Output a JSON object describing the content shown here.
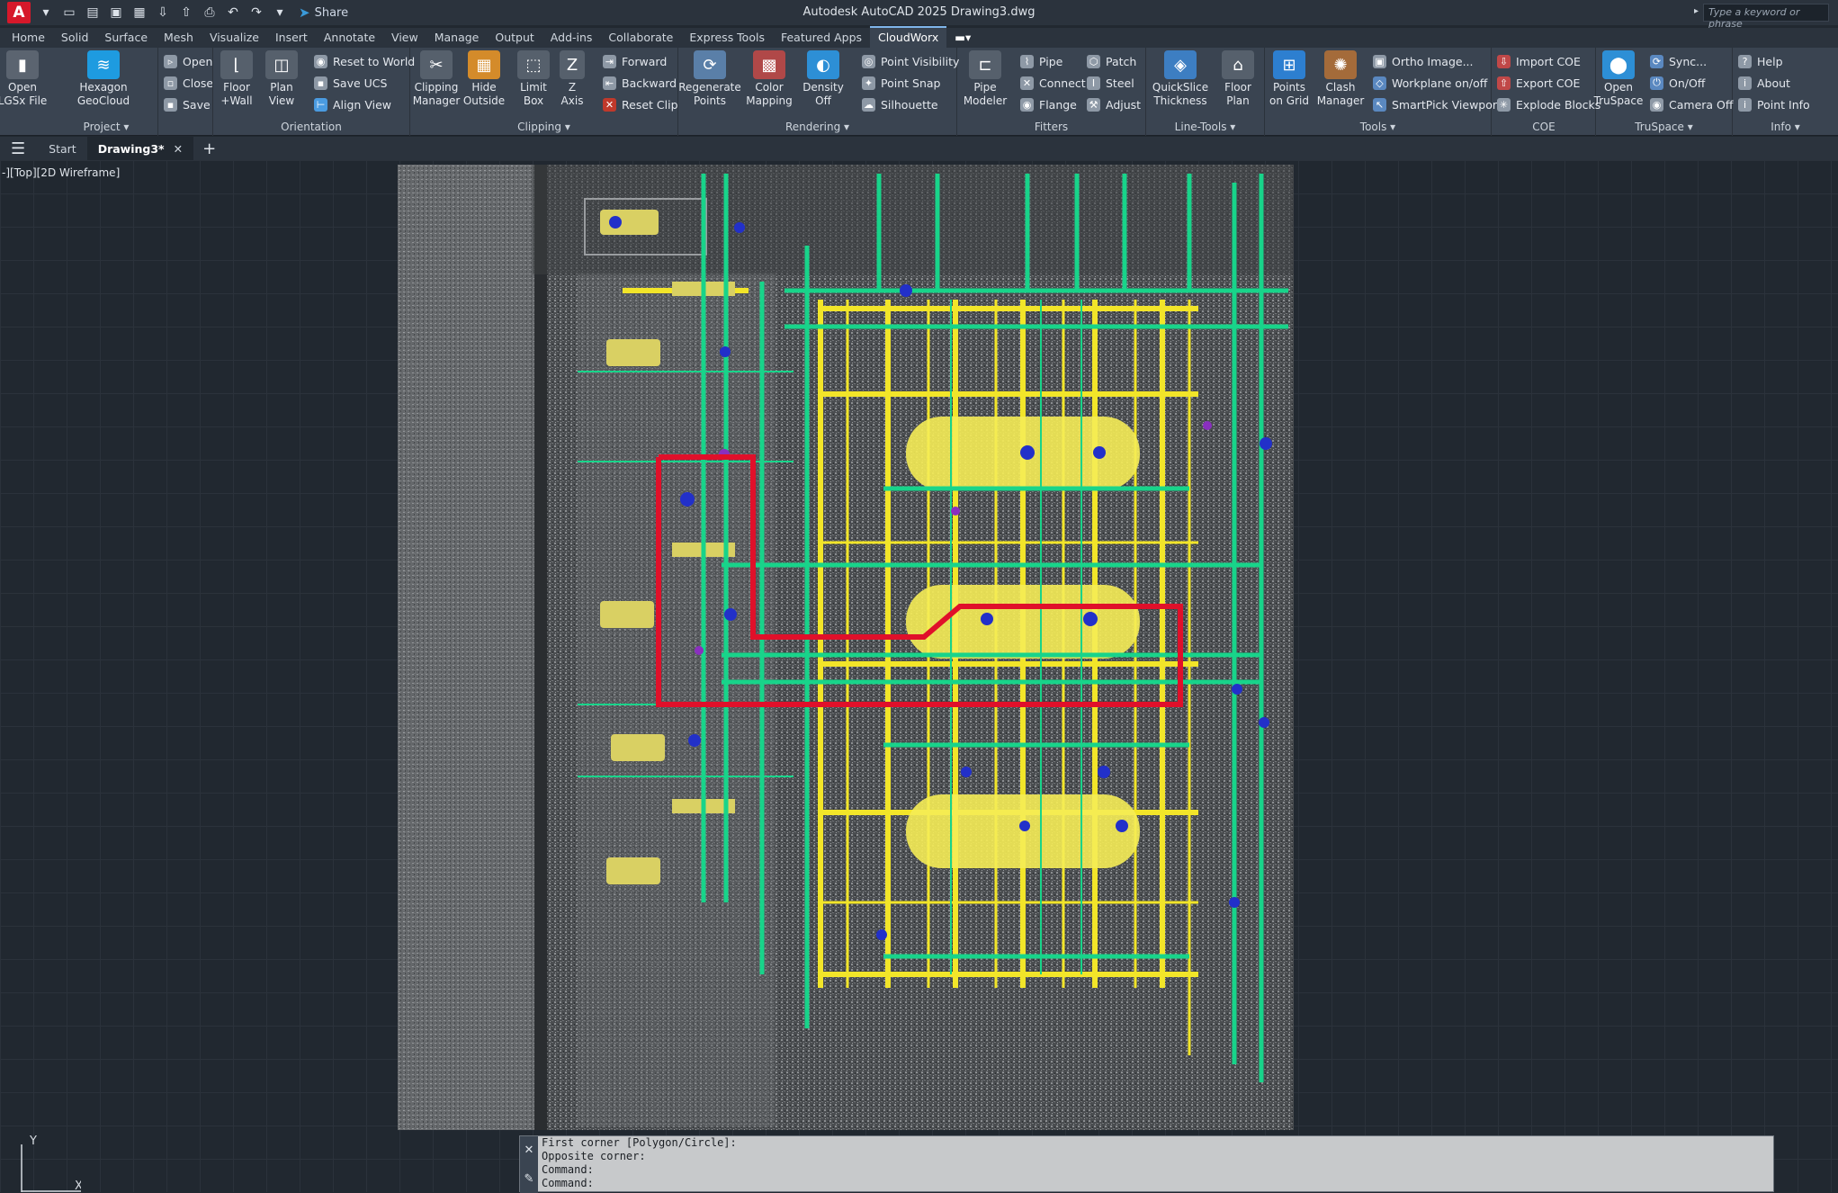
{
  "app": {
    "logo_letter": "A",
    "title": "Autodesk AutoCAD 2025    Drawing3.dwg",
    "share_label": "Share",
    "search_placeholder": "Type a keyword or phrase"
  },
  "tabs": [
    "Home",
    "Solid",
    "Surface",
    "Mesh",
    "Visualize",
    "Insert",
    "Annotate",
    "View",
    "Manage",
    "Output",
    "Add-ins",
    "Collaborate",
    "Express Tools",
    "Featured Apps",
    "CloudWorx"
  ],
  "active_tab": "CloudWorx",
  "ribbon": {
    "project": {
      "title": "Project",
      "open_lgsx": "Open\nLGSx File",
      "hexagon": "Hexagon GeoCloud",
      "open": "Open",
      "close": "Close",
      "save": "Save"
    },
    "orientation": {
      "title": "Orientation",
      "floor_wall": "Floor\n+Wall",
      "plan_view": "Plan\nView",
      "reset_world": "Reset to World",
      "save_ucs": "Save UCS",
      "align_view": "Align View"
    },
    "clipping": {
      "title": "Clipping",
      "manager": "Clipping\nManager",
      "hide_outside": "Hide\nOutside",
      "limit_box": "Limit\nBox",
      "z_axis": "Z\nAxis",
      "forward": "Forward",
      "backward": "Backward",
      "reset_clip": "Reset Clip"
    },
    "rendering": {
      "title": "Rendering",
      "regenerate": "Regenerate\nPoints",
      "color_mapping": "Color\nMapping",
      "density_off": "Density\nOff",
      "point_visibility": "Point Visibility",
      "point_snap": "Point Snap",
      "silhouette": "Silhouette"
    },
    "fitters": {
      "title": "Fitters",
      "pipe_modeler": "Pipe\nModeler",
      "pipe": "Pipe",
      "connect": "Connect",
      "flange": "Flange",
      "patch": "Patch",
      "steel": "Steel",
      "adjust": "Adjust"
    },
    "linetools": {
      "title": "Line-Tools",
      "quickslice": "QuickSlice\nThickness",
      "floor_plan": "Floor\nPlan"
    },
    "tools": {
      "title": "Tools",
      "points_grid": "Points\non Grid",
      "clash": "Clash\nManager",
      "ortho": "Ortho Image...",
      "workplane": "Workplane on/off",
      "smartpick": "SmartPick Viewport"
    },
    "coe": {
      "title": "COE",
      "import": "Import COE",
      "export": "Export COE",
      "explode": "Explode Blocks"
    },
    "truspace": {
      "title": "TruSpace",
      "open": "Open\nTruSpace",
      "sync": "Sync...",
      "onoff": "On/Off",
      "camera": "Camera Off"
    },
    "info": {
      "title": "Info",
      "help": "Help",
      "about": "About",
      "point_info": "Point Info"
    }
  },
  "doc_tabs": {
    "start": "Start",
    "drawing": "Drawing3*"
  },
  "viewport_label": "-][Top][2D Wireframe]",
  "ucs": {
    "y": "Y",
    "x": "X"
  },
  "command_lines": [
    "First corner [Polygon/Circle]:",
    "Opposite corner:",
    "Command:",
    "Command:"
  ],
  "colors": {
    "accent": "#7fb5ea",
    "selection_outline": "#e0102a",
    "pipe_green": "#18d48a",
    "steel_yellow": "#f2e529"
  }
}
